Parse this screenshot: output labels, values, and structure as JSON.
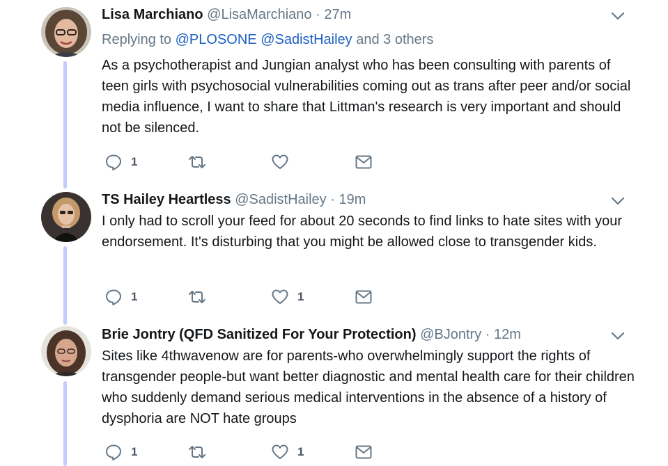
{
  "tweets": [
    {
      "name": "Lisa Marchiano",
      "handle": "@LisaMarchiano",
      "dot": "·",
      "time": "27m",
      "reply_prefix": "Replying to",
      "reply_links": [
        "@PLOSONE",
        "@SadistHailey"
      ],
      "reply_suffix": "and 3 others",
      "text": "As a psychotherapist and Jungian analyst who has been consulting with parents of teen girls with psychosocial vulnerabilities coming out as trans after peer and/or social media influence, I want to share that Littman's research is very important and should not be silenced.",
      "reply_count": "1",
      "retweet_count": "",
      "like_count": ""
    },
    {
      "name": "TS Hailey Heartless",
      "handle": "@SadistHailey",
      "dot": "·",
      "time": "19m",
      "text": "I only had to scroll your feed for about 20 seconds to find links to hate sites with your endorsement. It's disturbing that you might be allowed close to transgender kids.",
      "reply_count": "1",
      "retweet_count": "",
      "like_count": "1"
    },
    {
      "name": "Brie Jontry (QFD Sanitized For Your Protection)",
      "handle": "@BJontry",
      "dot": "·",
      "time": "12m",
      "text": "Sites like 4thwavenow are for parents-who overwhelmingly support the rights of transgender people-but want better diagnostic and mental health care for their children who suddenly demand serious medical interventions in the absence of a history of dysphoria are NOT hate groups",
      "reply_count": "1",
      "retweet_count": "",
      "like_count": "1"
    }
  ],
  "icons": {
    "reply": "reply-icon",
    "retweet": "retweet-icon",
    "like": "heart-icon",
    "message": "envelope-icon",
    "more": "chevron-down-icon"
  },
  "colors": {
    "thread_line": "#c1cdfc",
    "link": "#1b5fc1",
    "secondary_text": "#657786",
    "icon": "#657786"
  }
}
